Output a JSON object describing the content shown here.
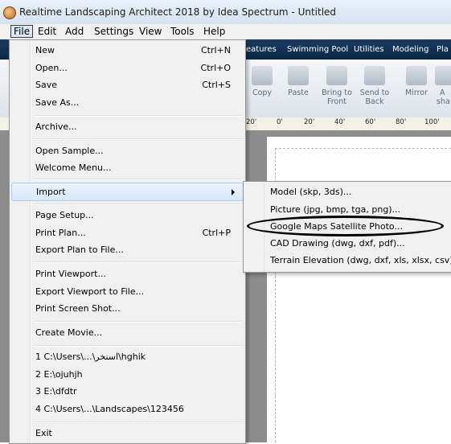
{
  "window": {
    "title": "Realtime Landscaping Architect 2018 by Idea Spectrum - Untitled"
  },
  "menubar": {
    "items": [
      "File",
      "Edit",
      "Add",
      "Settings",
      "View",
      "Tools",
      "Help"
    ]
  },
  "ribbon": {
    "tabs": [
      "eatures",
      "Swimming Pool",
      "Utilities",
      "Modeling",
      "Pla"
    ],
    "buttons": [
      {
        "line1": "Copy",
        "line2": ""
      },
      {
        "line1": "Paste",
        "line2": ""
      },
      {
        "line1": "Bring to",
        "line2": "Front"
      },
      {
        "line1": "Send to",
        "line2": "Back"
      },
      {
        "line1": "Mirror",
        "line2": ""
      },
      {
        "line1": "A",
        "line2": "sha"
      }
    ]
  },
  "ruler": {
    "ticks": [
      "20'",
      "0'",
      "20'",
      "40'",
      "60'",
      "80'",
      "100'"
    ]
  },
  "file_menu": {
    "items": [
      {
        "label": "New",
        "shortcut": "Ctrl+N"
      },
      {
        "label": "Open...",
        "shortcut": "Ctrl+O"
      },
      {
        "label": "Save",
        "shortcut": "Ctrl+S"
      },
      {
        "label": "Save As...",
        "shortcut": ""
      },
      {
        "label": "Archive...",
        "shortcut": ""
      },
      {
        "label": "Open Sample...",
        "shortcut": ""
      },
      {
        "label": "Welcome Menu...",
        "shortcut": ""
      },
      {
        "label": "Import",
        "shortcut": ""
      },
      {
        "label": "Page Setup...",
        "shortcut": ""
      },
      {
        "label": "Print Plan...",
        "shortcut": "Ctrl+P"
      },
      {
        "label": "Export Plan to File...",
        "shortcut": ""
      },
      {
        "label": "Print Viewport...",
        "shortcut": ""
      },
      {
        "label": "Export Viewport to File...",
        "shortcut": ""
      },
      {
        "label": "Print Screen Shot...",
        "shortcut": ""
      },
      {
        "label": "Create Movie...",
        "shortcut": ""
      },
      {
        "label": "1 C:\\Users\\...\\اسنخر\\hghik",
        "shortcut": ""
      },
      {
        "label": "2 E:\\ojuhjh",
        "shortcut": ""
      },
      {
        "label": "3 E:\\dfdtr",
        "shortcut": ""
      },
      {
        "label": "4 C:\\Users\\...\\Landscapes\\123456",
        "shortcut": ""
      },
      {
        "label": "Exit",
        "shortcut": ""
      }
    ]
  },
  "import_submenu": {
    "items": [
      "Model (skp, 3ds)...",
      "Picture (jpg, bmp, tga, png)...",
      "Google Maps Satellite Photo...",
      "CAD Drawing (dwg, dxf, pdf)...",
      "Terrain Elevation (dwg, dxf, xls, xlsx, csv)..."
    ]
  }
}
